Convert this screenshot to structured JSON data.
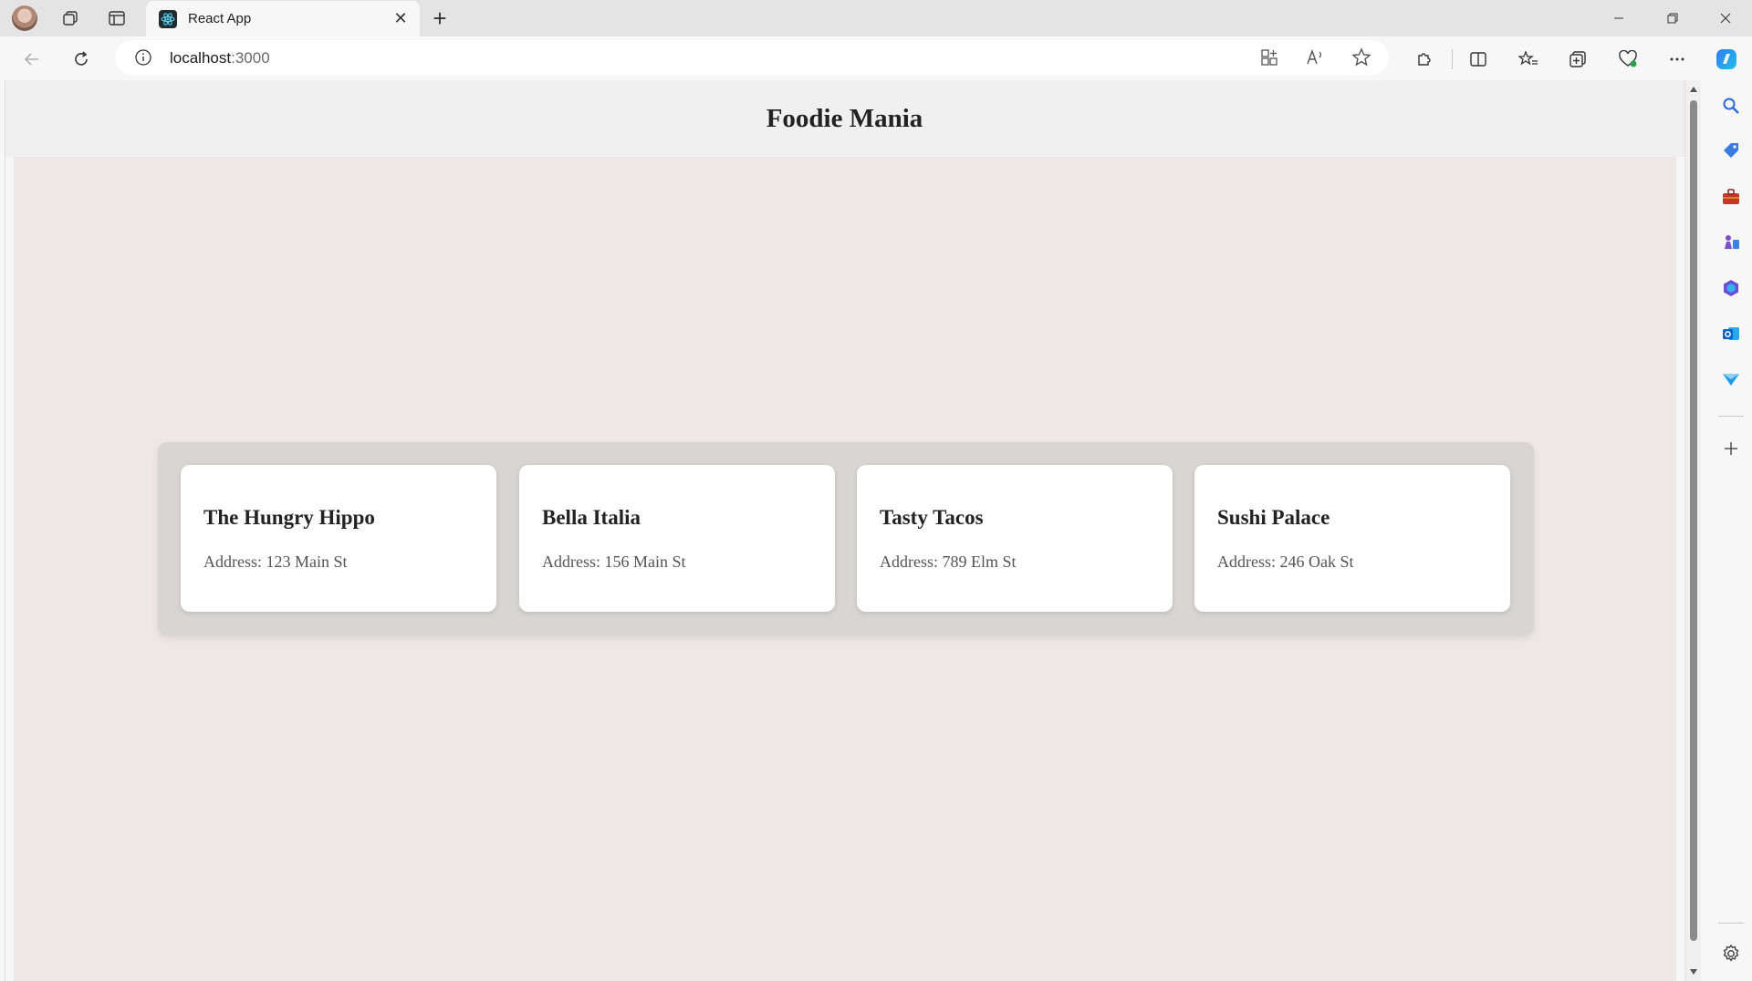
{
  "browser": {
    "tab_title": "React App",
    "url_host": "localhost",
    "url_port": ":3000",
    "new_tab_glyph": "+",
    "close_glyph": "✕",
    "window_controls": {
      "minimize": "—",
      "restore": "❐",
      "close": "✕"
    },
    "toolbar_icons": [
      "back-icon",
      "refresh-icon",
      "info-icon",
      "app-available-icon",
      "read-aloud-icon",
      "favorite-star-icon",
      "extensions-icon",
      "split-screen-icon",
      "favorites-icon",
      "collections-icon",
      "browser-essentials-icon",
      "more-icon",
      "copilot-icon"
    ],
    "sidebar_icons": [
      "search-icon",
      "shopping-icon",
      "tools-icon",
      "games-icon",
      "microsoft365-icon",
      "outlook-icon",
      "send-icon",
      "add-icon",
      "settings-icon"
    ]
  },
  "app": {
    "title": "Foodie Mania",
    "restaurants": [
      {
        "name": "The Hungry Hippo",
        "address": "Address: 123 Main St"
      },
      {
        "name": "Bella Italia",
        "address": "Address: 156 Main St"
      },
      {
        "name": "Tasty Tacos",
        "address": "Address: 789 Elm St"
      },
      {
        "name": "Sushi Palace",
        "address": "Address: 246 Oak St"
      }
    ]
  },
  "colors": {
    "page_background": "#efe6e6",
    "header_background": "#f1f0f0",
    "card_container": "#d9d5d5",
    "card": "#ffffff"
  }
}
